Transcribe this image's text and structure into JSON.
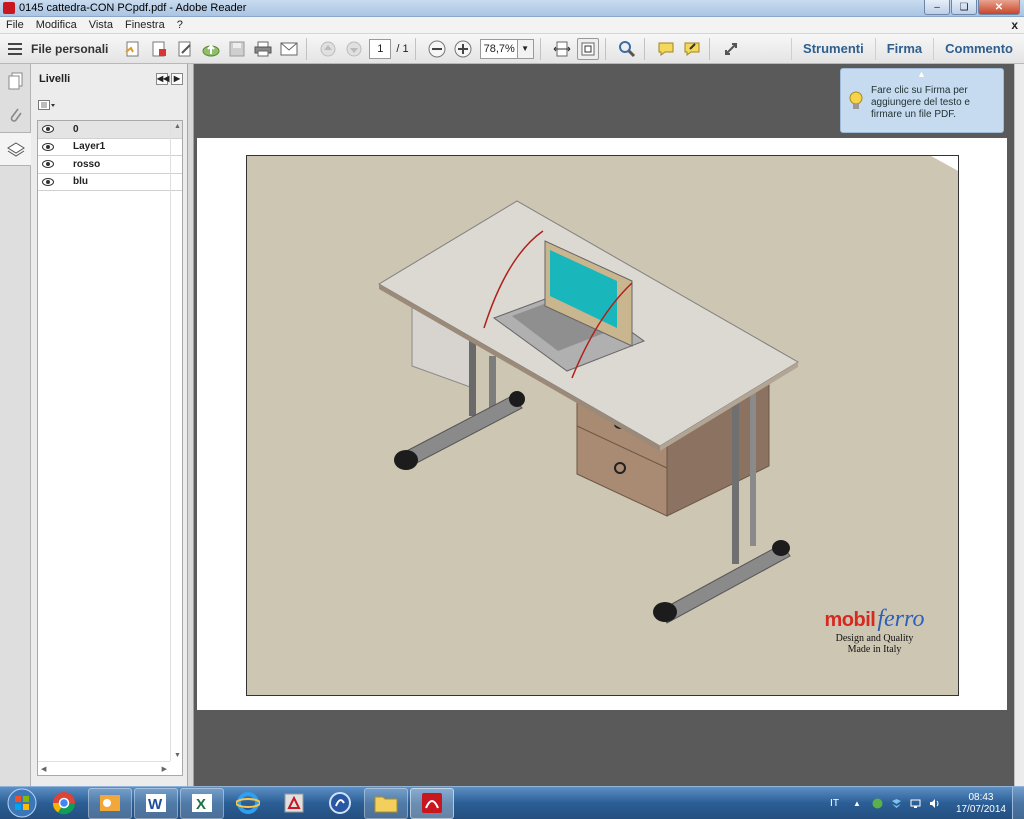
{
  "window": {
    "title": "0145 cattedra-CON PCpdf.pdf - Adobe Reader"
  },
  "menu": {
    "items": [
      "File",
      "Modifica",
      "Vista",
      "Finestra",
      "?"
    ],
    "close_doc": "x"
  },
  "toolbar": {
    "files_label": "File personali",
    "page_current": "1",
    "page_total": "/ 1",
    "zoom": "78,7%",
    "right_links": [
      "Strumenti",
      "Firma",
      "Commento"
    ]
  },
  "layers_panel": {
    "title": "Livelli",
    "layers": [
      "0",
      "Layer1",
      "rosso",
      "blu"
    ]
  },
  "tip": {
    "text": "Fare clic su Firma per aggiungere del testo e firmare un file PDF."
  },
  "drawing": {
    "brand_part1": "mobil",
    "brand_part2": "ferro",
    "tagline1": "Design and Quality",
    "tagline2": "Made in Italy"
  },
  "taskbar": {
    "apps": [
      "start-orb",
      "chrome",
      "outlook",
      "word",
      "excel",
      "internet-explorer",
      "acrobat-pro",
      "dragon",
      "file-explorer",
      "adobe-reader"
    ],
    "language": "IT",
    "time": "08:43",
    "date": "17/07/2014"
  },
  "colors": {
    "accent_link": "#2f5f8e",
    "drawing_bg": "#cdc6b2",
    "brand_red": "#d42a22",
    "brand_blue": "#2b5fb9",
    "taskbar": "#2b5e95"
  }
}
